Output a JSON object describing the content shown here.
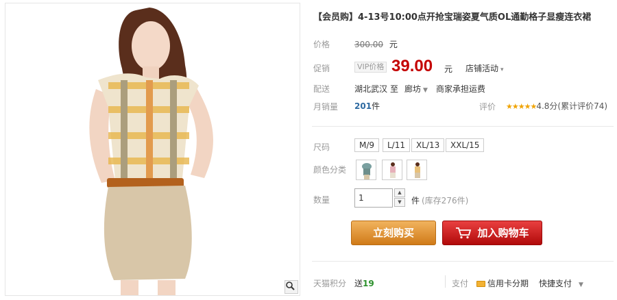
{
  "product": {
    "title": "【会员购】4-13号10:00点开抢宝瑞姿夏气质OL通勤格子显瘦连衣裙"
  },
  "price": {
    "label": "价格",
    "original": "300.00",
    "currency": "元"
  },
  "promo": {
    "label": "促销",
    "vip_tag": "VIP价格",
    "sale_price": "39.00",
    "currency": "元",
    "shop_activity": "店铺活动"
  },
  "delivery": {
    "label": "配送",
    "from": "湖北武汉",
    "to_word": "至",
    "destination": "廊坊",
    "shipping_note": "商家承担运费"
  },
  "sales": {
    "label": "月销量",
    "count": "201",
    "unit": "件",
    "rating_label": "评价",
    "stars": "★★★★★",
    "rating_text": "4.8分(累计评价74)",
    "rating_value": 4.8
  },
  "size": {
    "label": "尺码",
    "options": [
      "M/9",
      "L/11",
      "XL/13",
      "XXL/15"
    ]
  },
  "color": {
    "label": "颜色分类",
    "options": [
      "color-option-1",
      "color-option-2",
      "color-option-3"
    ]
  },
  "quantity": {
    "label": "数量",
    "value": "1",
    "unit": "件",
    "stock": "(库存276件)"
  },
  "actions": {
    "buy_now": "立刻购买",
    "add_to_cart": "加入购物车"
  },
  "bottom": {
    "points_label": "天猫积分",
    "points_prefix": "送",
    "points_value": "19",
    "pay_label": "支付",
    "credit_card": "信用卡分期",
    "quick_pay": "快捷支付"
  },
  "colors": {
    "price_red": "#c40000",
    "buy_orange": "#e09a3a",
    "cart_red": "#c41a1a"
  }
}
